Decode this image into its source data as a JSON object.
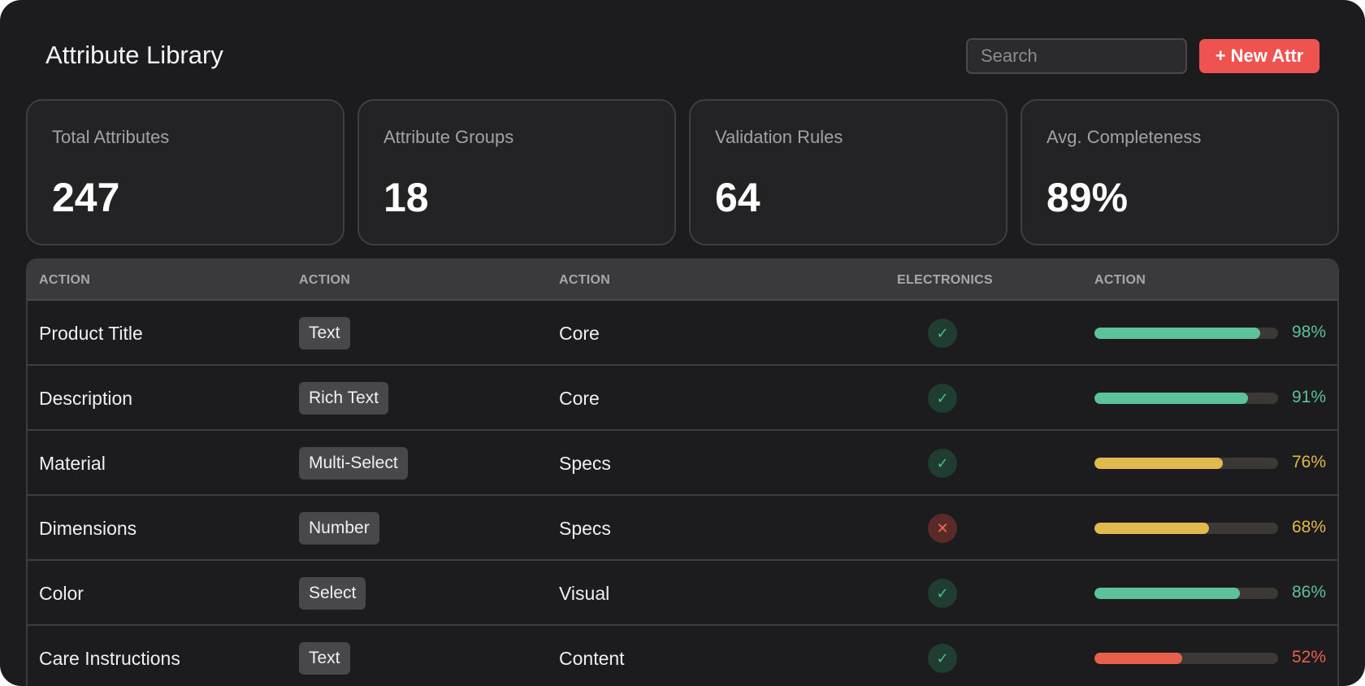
{
  "header": {
    "title": "Attribute Library",
    "search_placeholder": "Search",
    "new_button_label": "+ New Attr"
  },
  "stats": [
    {
      "label": "Total Attributes",
      "value": "247"
    },
    {
      "label": "Attribute Groups",
      "value": "18"
    },
    {
      "label": "Validation Rules",
      "value": "64"
    },
    {
      "label": "Avg. Completeness",
      "value": "89%"
    }
  ],
  "table": {
    "columns": [
      "ACTION",
      "ACTION",
      "ACTION",
      "ELECTRONICS",
      "ACTION"
    ],
    "rows": [
      {
        "name": "Product Title",
        "type": "Text",
        "group": "Core",
        "electronics": "check-icon",
        "completeness": 98,
        "completeness_label": "98%"
      },
      {
        "name": "Description",
        "type": "Rich Text",
        "group": "Core",
        "electronics": "check-icon",
        "completeness": 91,
        "completeness_label": "91%"
      },
      {
        "name": "Material",
        "type": "Multi-Select",
        "group": "Specs",
        "electronics": "check-icon",
        "completeness": 76,
        "completeness_label": "76%"
      },
      {
        "name": "Dimensions",
        "type": "Number",
        "group": "Specs",
        "electronics": "close-icon",
        "completeness": 68,
        "completeness_label": "68%"
      },
      {
        "name": "Color",
        "type": "Select",
        "group": "Visual",
        "electronics": "check-icon",
        "completeness": 86,
        "completeness_label": "86%"
      },
      {
        "name": "Care Instructions",
        "type": "Text",
        "group": "Content",
        "electronics": "check-icon",
        "completeness": 52,
        "completeness_label": "52%"
      }
    ]
  },
  "colors": {
    "accent": "#ef5350",
    "high": "#5cc29a",
    "medium": "#e1b94c",
    "low": "#e8604a"
  }
}
